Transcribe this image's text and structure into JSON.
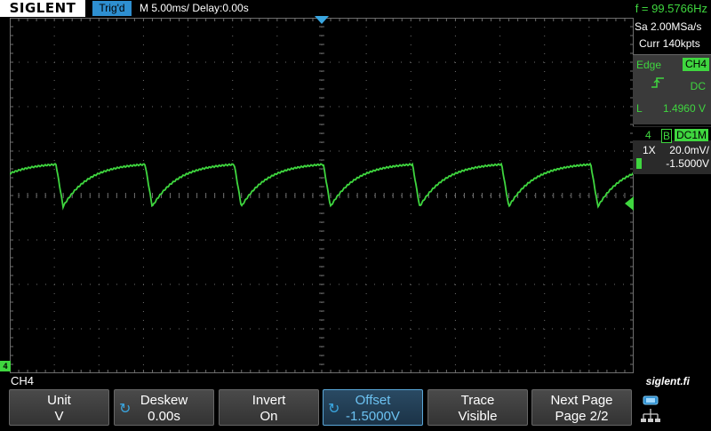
{
  "header": {
    "brand": "SIGLENT",
    "trigger_status": "Trig'd",
    "timebase": "M 5.00ms/ Delay:0.00s",
    "frequency": "f = 99.5766Hz"
  },
  "acquisition": {
    "sample_rate": "Sa 2.00MSa/s",
    "memory": "Curr 140kpts"
  },
  "trigger_panel": {
    "type": "Edge",
    "source": "CH4",
    "coupling": "DC",
    "level_label": "L",
    "level": "1.4960 V"
  },
  "channel_panel": {
    "channel": "4",
    "bandwidth": "B",
    "coupling": "DC1M",
    "probe": "1X",
    "volts_div": "20.0mV/",
    "offset": "-1.5000V"
  },
  "bottom": {
    "channel_label": "CH4",
    "website": "siglent.fi",
    "channel_marker": "4"
  },
  "softkeys": [
    {
      "label": "Unit",
      "value": "V",
      "knob": false,
      "active": false
    },
    {
      "label": "Deskew",
      "value": "0.00s",
      "knob": true,
      "active": false
    },
    {
      "label": "Invert",
      "value": "On",
      "knob": false,
      "active": false
    },
    {
      "label": "Offset",
      "value": "-1.5000V",
      "knob": true,
      "active": true
    },
    {
      "label": "Trace",
      "value": "Visible",
      "knob": false,
      "active": false
    },
    {
      "label": "Next Page",
      "value": "Page 2/2",
      "knob": false,
      "active": false
    }
  ],
  "colors": {
    "channel4": "#3fd63f",
    "trigger": "#3aa6e0",
    "grid": "#6e6e6e"
  },
  "chart_data": {
    "type": "line",
    "series": [
      {
        "waveform": "sawtooth-decay",
        "period_divisions": 2.0,
        "cycles_visible": 7,
        "high_level_div": -0.7,
        "low_level_div": 0.25
      }
    ],
    "grid": true,
    "x_divisions": 14,
    "y_divisions": 8
  }
}
